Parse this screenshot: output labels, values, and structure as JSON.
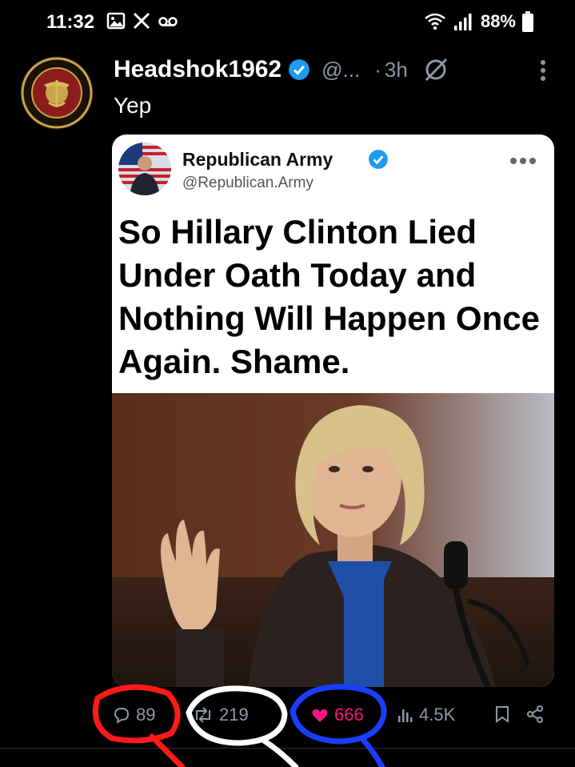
{
  "status_bar": {
    "time": "11:32",
    "battery": "88%"
  },
  "tweet": {
    "display_name": "Headshok1962",
    "handle": "@...",
    "separator": "·",
    "time_ago": "3h",
    "text": "Yep"
  },
  "quoted_post": {
    "display_name": "Republican Army",
    "handle": "@Republican.Army",
    "headline": "So Hillary Clinton Lied Under Oath Today and Nothing Will Happen Once Again. Shame."
  },
  "actions": {
    "replies": "89",
    "reposts": "219",
    "likes": "666",
    "views": "4.5K"
  },
  "colors": {
    "background": "#000000",
    "verified": "#1d9bf0",
    "like": "#f91880",
    "annotation_red": "#ff1a1a",
    "annotation_white": "#ffffff",
    "annotation_blue": "#1a3dff"
  },
  "icons": [
    "gallery-icon",
    "x-logo-icon",
    "voicemail-icon",
    "wifi-icon",
    "signal-icon",
    "battery-icon",
    "verified-icon",
    "grok-icon",
    "more-icon",
    "reply-icon",
    "retweet-icon",
    "heart-icon",
    "views-icon",
    "bookmark-icon",
    "share-icon"
  ]
}
